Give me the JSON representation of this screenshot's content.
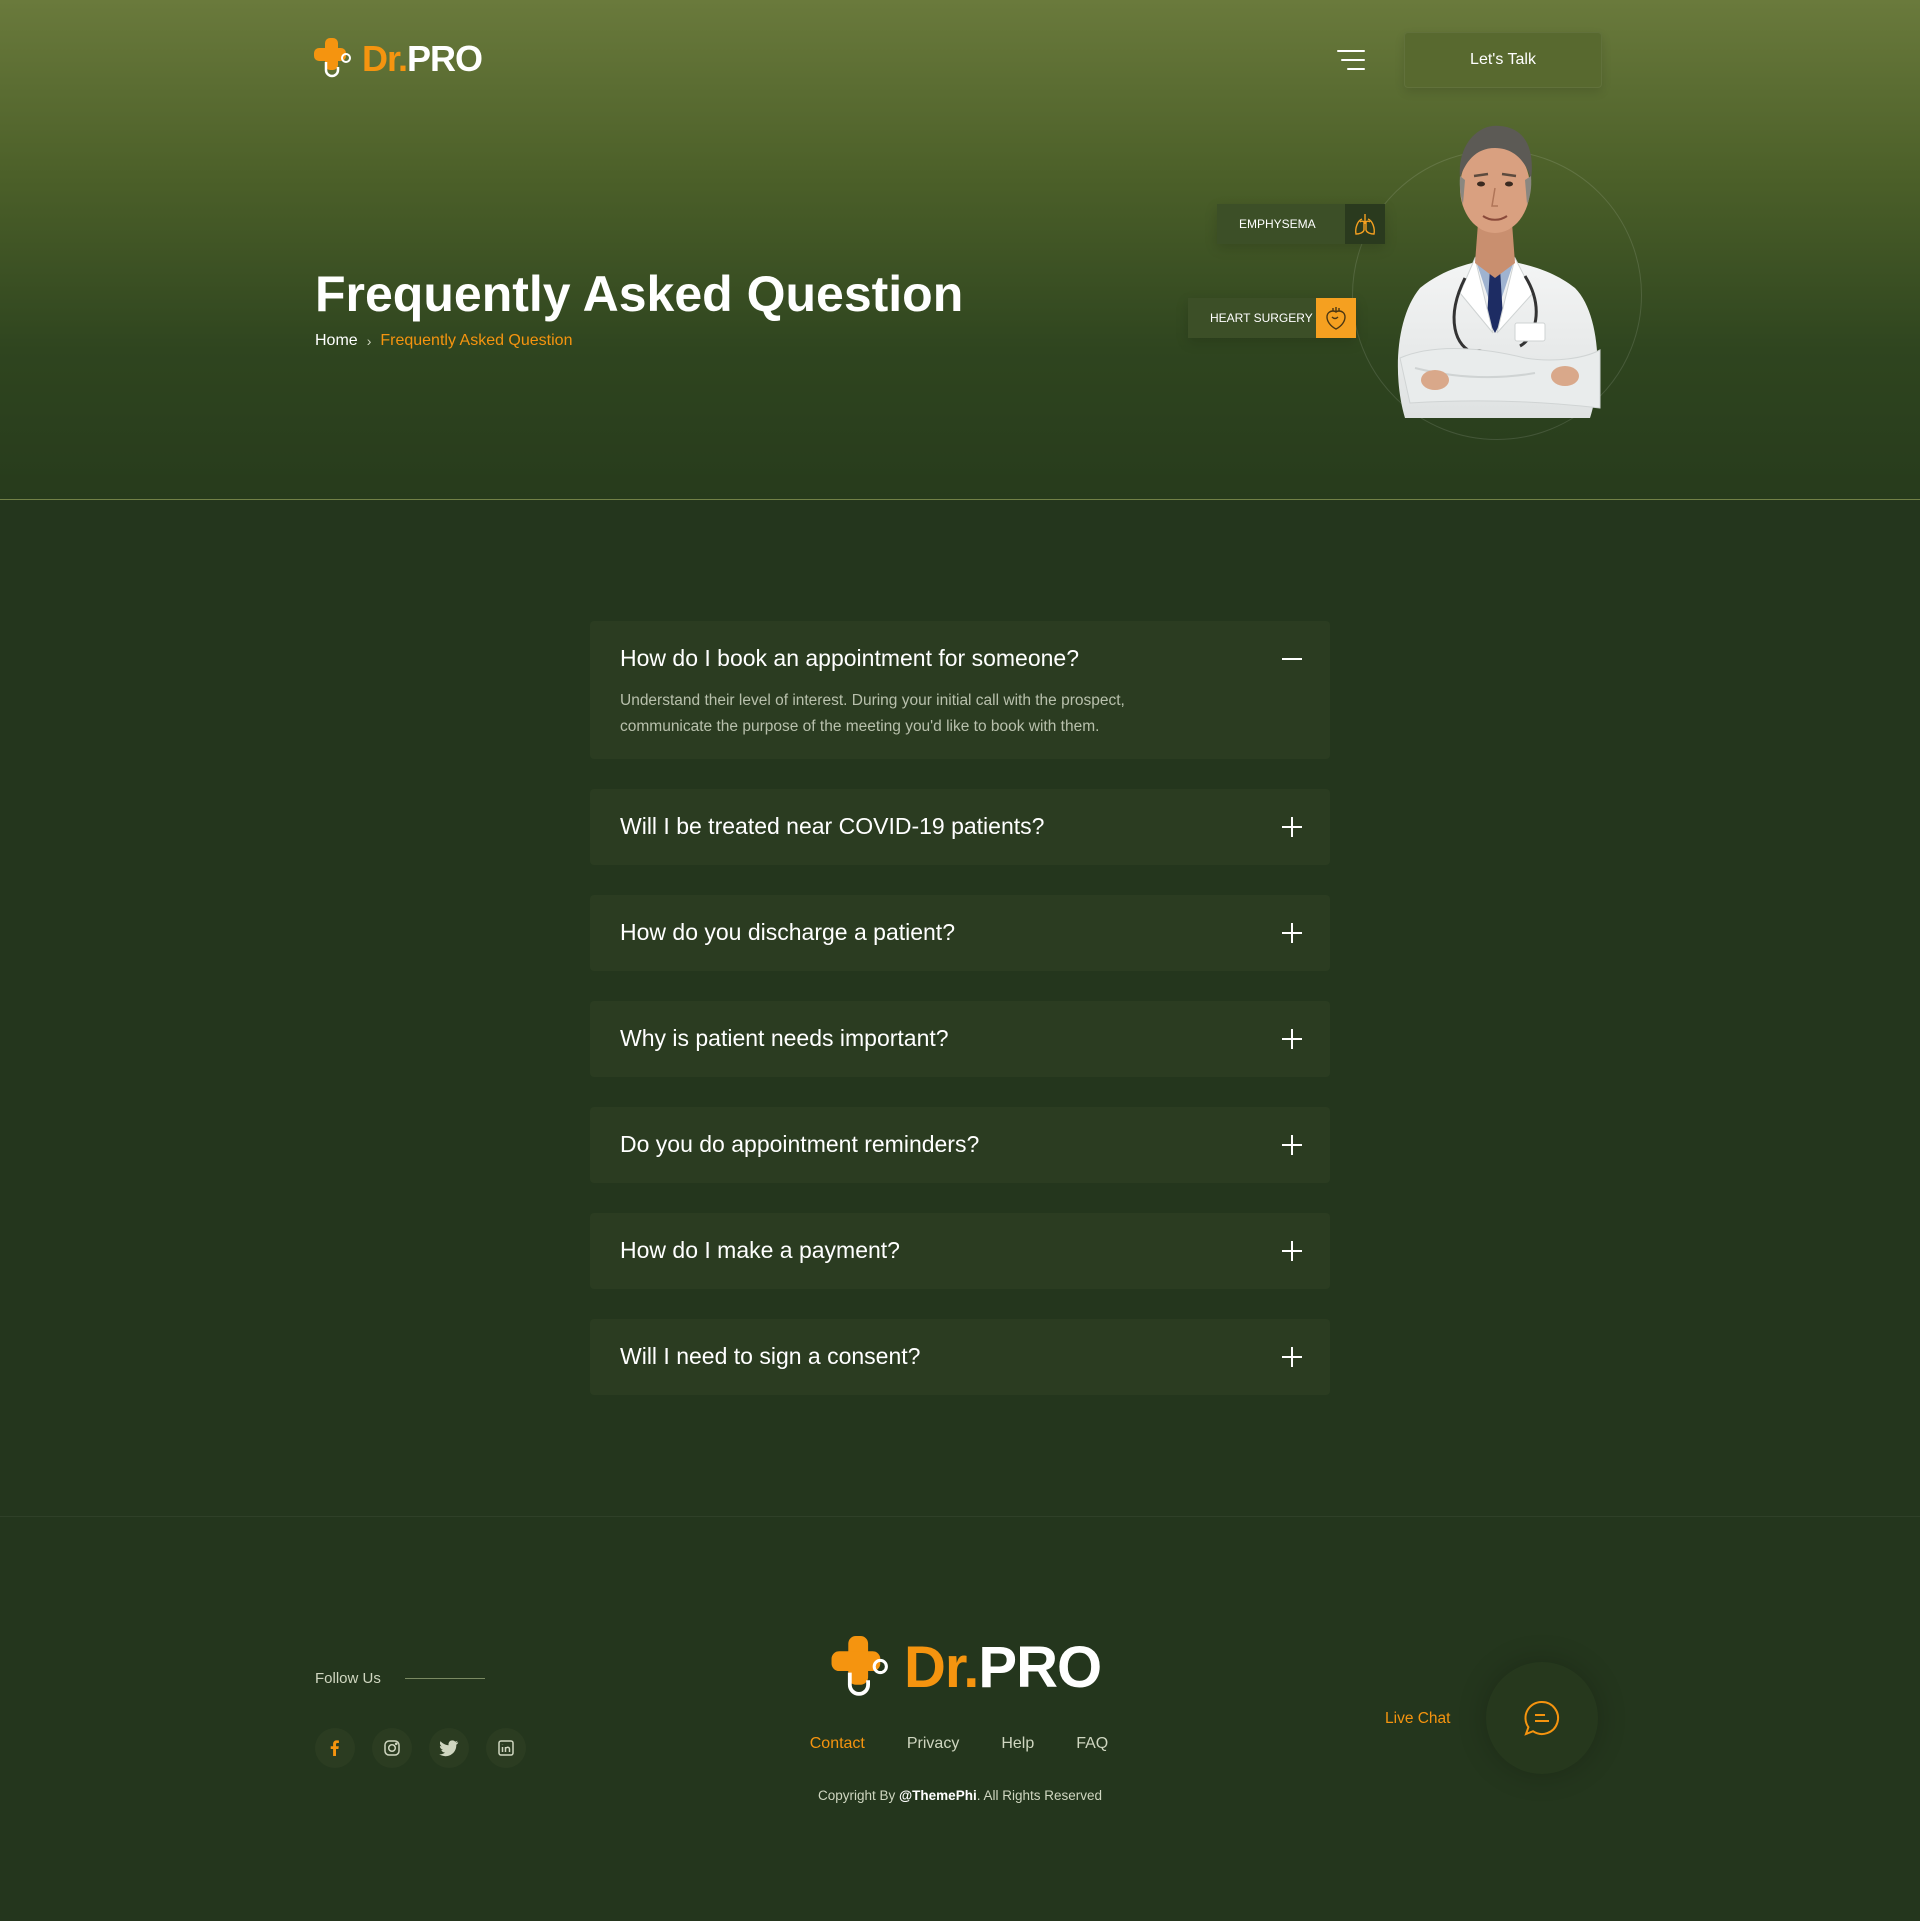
{
  "header": {
    "logo": {
      "dr": "Dr",
      "dot": ".",
      "pro": "PRO"
    },
    "cta_label": "Let's Talk"
  },
  "hero": {
    "title": "Frequently Asked Question",
    "breadcrumb": {
      "home": "Home",
      "separator": "›",
      "current": "Frequently Asked Question"
    },
    "tags": [
      {
        "label": "EMPHYSEMA",
        "icon": "lungs-icon"
      },
      {
        "label": "HEART SURGERY",
        "icon": "heart-icon"
      }
    ]
  },
  "faq": [
    {
      "question": "How do I book an appointment for someone?",
      "answer": "Understand their level of interest. During your initial call with the prospect, communicate the purpose of the meeting you'd like to book with them.",
      "open": true
    },
    {
      "question": "Will I be treated near COVID-19 patients?",
      "open": false
    },
    {
      "question": "How do you discharge a patient?",
      "open": false
    },
    {
      "question": "Why is patient needs important?",
      "open": false
    },
    {
      "question": "Do you do appointment reminders?",
      "open": false
    },
    {
      "question": "How do I make a payment?",
      "open": false
    },
    {
      "question": "Will I need to sign a consent?",
      "open": false
    }
  ],
  "footer": {
    "follow_label": "Follow Us",
    "socials": [
      "facebook-icon",
      "instagram-icon",
      "twitter-icon",
      "linkedin-icon"
    ],
    "logo": {
      "dr": "Dr",
      "dot": ".",
      "pro": "PRO"
    },
    "nav": [
      "Contact",
      "Privacy",
      "Help",
      "FAQ"
    ],
    "copyright": {
      "prefix": "Copyright By ",
      "brand": "@ThemePhi",
      "suffix": ". All Rights Reserved"
    },
    "live_chat_label": "Live Chat"
  },
  "colors": {
    "accent": "#f5940f",
    "background": "#24361d",
    "card": "#2b3c21"
  }
}
